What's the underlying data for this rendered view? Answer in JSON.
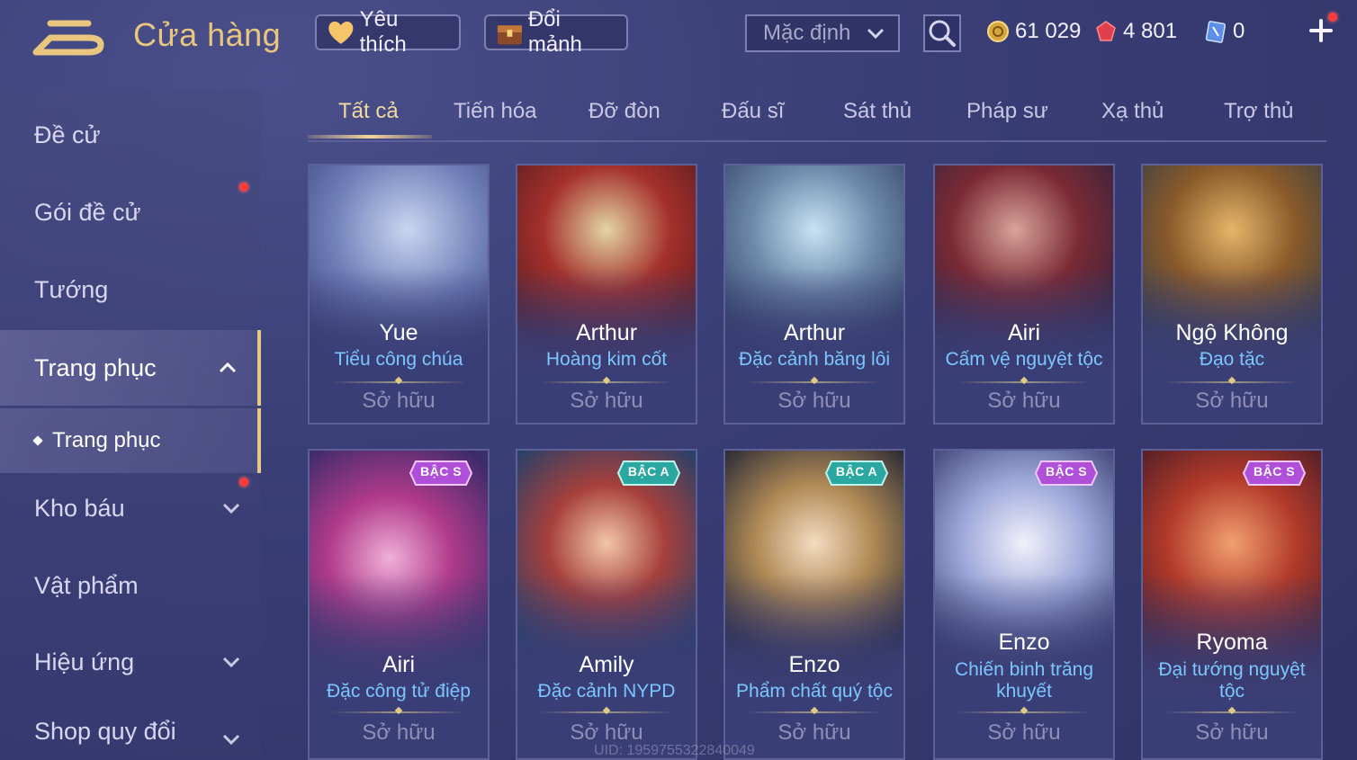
{
  "header": {
    "title": "Cửa hàng",
    "favorites_label": "Yêu thích",
    "shard_exchange_label": "Đổi mảnh",
    "sort_value": "Mặc định",
    "gold": "61 029",
    "gems": "4 801",
    "tickets": "0"
  },
  "sidebar": {
    "items": [
      {
        "label": "Đề cử"
      },
      {
        "label": "Gói đề cử"
      },
      {
        "label": "Tướng"
      },
      {
        "label": "Trang phục"
      },
      {
        "label": "Kho báu"
      },
      {
        "label": "Vật phẩm"
      },
      {
        "label": "Hiệu ứng"
      },
      {
        "label": "Shop quy đổi"
      }
    ],
    "sub_item": "Trang phục"
  },
  "tabs": [
    "Tất cả",
    "Tiến hóa",
    "Đỡ đòn",
    "Đấu sĩ",
    "Sát thủ",
    "Pháp sư",
    "Xạ thủ",
    "Trợ thủ"
  ],
  "cards": [
    {
      "hero": "Yue",
      "skin": "Tiểu công chúa",
      "status": "Sở hữu",
      "badge": ""
    },
    {
      "hero": "Arthur",
      "skin": "Hoàng kim cốt",
      "status": "Sở hữu",
      "badge": ""
    },
    {
      "hero": "Arthur",
      "skin": "Đặc cảnh băng lôi",
      "status": "Sở hữu",
      "badge": ""
    },
    {
      "hero": "Airi",
      "skin": "Cấm vệ nguyệt tộc",
      "status": "Sở hữu",
      "badge": ""
    },
    {
      "hero": "Ngộ Không",
      "skin": "Đạo tặc",
      "status": "Sở hữu",
      "badge": ""
    },
    {
      "hero": "Airi",
      "skin": "Đặc công tử điệp",
      "status": "Sở hữu",
      "badge": "BẬC S"
    },
    {
      "hero": "Amily",
      "skin": "Đặc cảnh NYPD",
      "status": "Sở hữu",
      "badge": "BẬC A"
    },
    {
      "hero": "Enzo",
      "skin": "Phẩm chất quý tộc",
      "status": "Sở hữu",
      "badge": "BẬC A"
    },
    {
      "hero": "Enzo",
      "skin_line1": "Chiến binh trăng",
      "skin_line2": "khuyết",
      "status": "Sở hữu",
      "badge": "BẬC S"
    },
    {
      "hero": "Ryoma",
      "skin_line1": "Đại tướng nguyệt",
      "skin_line2": "tộc",
      "status": "Sở hữu",
      "badge": "BẬC S"
    }
  ],
  "footer": {
    "uid": "UID: 1959755322840049"
  },
  "colors": {
    "accent_gold": "#e8c67e",
    "skin_blue": "#7cc6ff",
    "badge_s": "#b04fd8",
    "badge_a": "#2aa7a0"
  }
}
